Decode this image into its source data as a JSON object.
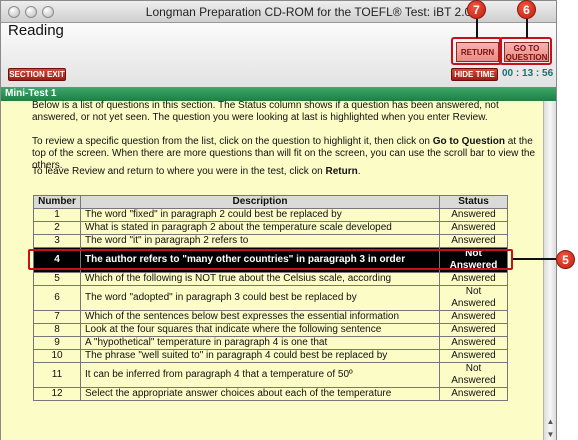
{
  "window": {
    "title": "Longman Preparation CD-ROM for the TOEFL® Test: iBT 2.0"
  },
  "header": {
    "section": "Reading",
    "section_exit": "SECTION EXIT",
    "hide_time": "HIDE TIME",
    "timer": "00 : 13 : 56",
    "return_label": "RETURN",
    "goto_line1": "GO TO",
    "goto_line2": "QUESTION"
  },
  "minitest": {
    "label": "Mini-Test 1"
  },
  "instructions": {
    "p1": "Below is a list of questions in this section. The Status column shows if a question has been answered, not answered, or not yet seen. The question you were looking at last is highlighted when you enter Review.",
    "p2_a": "To review a specific question from the list, click on the question to highlight it, then click on ",
    "p2_bold": "Go to Question",
    "p2_b": " at the top of the screen. When there are more questions than will fit on the screen, you can use the scroll bar to view the others.",
    "p3_a": "To leave Review and return to where you were in the test, click on ",
    "p3_bold": "Return",
    "p3_b": "."
  },
  "table": {
    "headers": [
      "Number",
      "Description",
      "Status"
    ],
    "rows": [
      {
        "number": "1",
        "description": "The word \"fixed\" in paragraph 2 could best be replaced by",
        "status": "Answered"
      },
      {
        "number": "2",
        "description": "What is stated in paragraph 2 about the temperature scale developed",
        "status": "Answered"
      },
      {
        "number": "3",
        "description": "The word \"it\" in paragraph 2 refers to",
        "status": "Answered"
      },
      {
        "number": "4",
        "description": "The author refers to \"many other countries\" in paragraph 3 in order",
        "status": "Not Answered"
      },
      {
        "number": "5",
        "description": "Which of the following is NOT true about the Celsius scale, according",
        "status": "Answered"
      },
      {
        "number": "6",
        "description": "The word \"adopted\" in paragraph 3 could best be replaced by",
        "status": "Not Answered"
      },
      {
        "number": "7",
        "description": "Which of the sentences below best expresses the essential information",
        "status": "Answered"
      },
      {
        "number": "8",
        "description": "Look at the four squares that indicate where the following sentence",
        "status": "Answered"
      },
      {
        "number": "9",
        "description": "A \"hypothetical\" temperature in paragraph 4 is one that",
        "status": "Answered"
      },
      {
        "number": "10",
        "description": "The phrase \"well suited to\" in paragraph 4 could best be replaced by",
        "status": "Answered"
      },
      {
        "number": "11",
        "description": "It can be inferred from paragraph 4 that a temperature of 50º",
        "status": "Not Answered"
      },
      {
        "number": "12",
        "description": "Select the appropriate answer choices about each of the temperature",
        "status": "Answered"
      }
    ]
  },
  "callouts": {
    "return": "7",
    "goto": "6",
    "row": "5"
  },
  "colors": {
    "accent_red": "#c8101a",
    "content_bg": "#fcfcc6",
    "minibar_green": "#1f7e45"
  }
}
